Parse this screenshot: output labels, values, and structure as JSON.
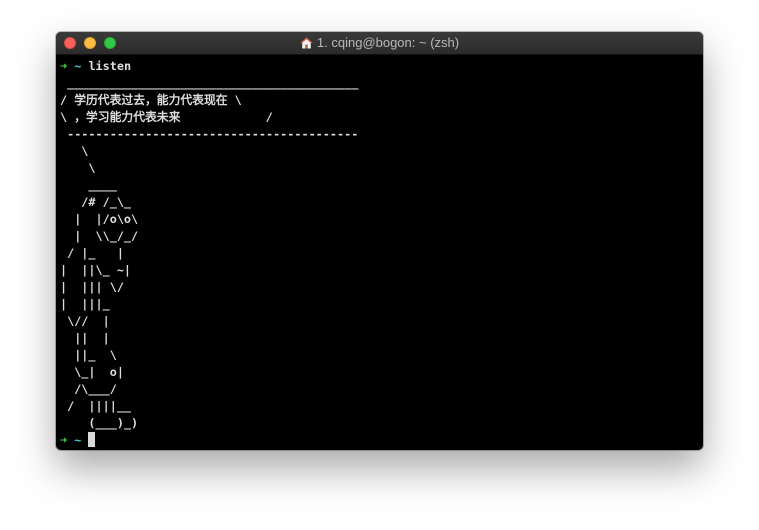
{
  "window": {
    "title": "1. cqing@bogon: ~ (zsh)"
  },
  "colors": {
    "prompt_arrow": "#3ee03e",
    "prompt_path": "#4fc8d8",
    "background": "#000000",
    "text": "#d6d6d6"
  },
  "prompt": {
    "arrow": "➜",
    "path": "~"
  },
  "command": "listen",
  "output_lines": [
    " _________________________________________",
    "/ 学历代表过去，能力代表现在 \\",
    "\\ ，学习能力代表未来            /",
    " -----------------------------------------",
    "   \\",
    "    \\",
    "    ____",
    "   /# /_\\_",
    "  |  |/o\\o\\",
    "  |  \\\\_/_/",
    " / |_   |",
    "|  ||\\_ ~|",
    "|  ||| \\/",
    "|  |||_",
    " \\//  |",
    "  ||  |",
    "  ||_  \\",
    "  \\_|  o|",
    "  /\\___/",
    " /  ||||__",
    "    (___)_)"
  ],
  "icons": {
    "title_icon": "home-icon"
  }
}
